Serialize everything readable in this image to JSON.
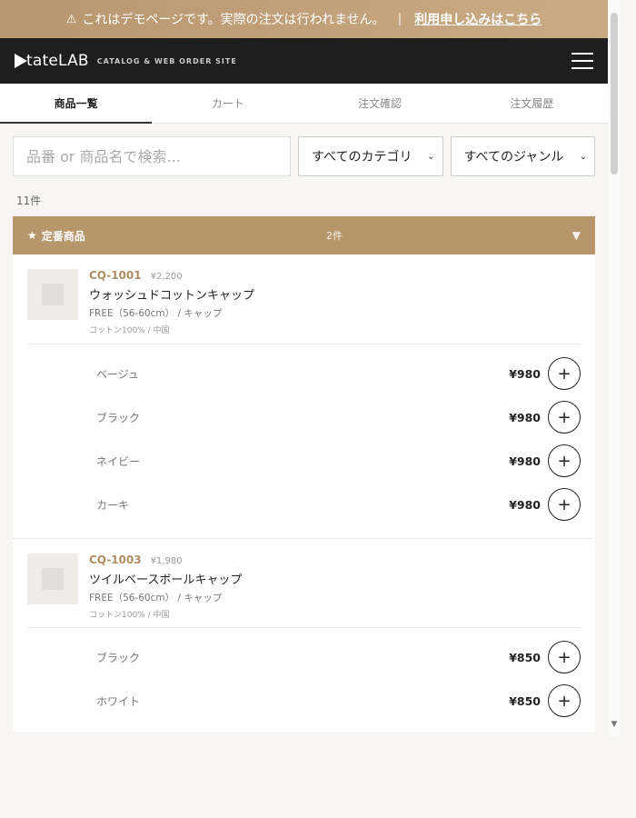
{
  "banner": {
    "icon": "warning-icon",
    "text": "これはデモページです。実際の注文は行われません。",
    "separator": "|",
    "link": "利用申し込みはこちら"
  },
  "header": {
    "logo_text": "tateLAB",
    "logo_sub": "CATALOG & WEB ORDER SITE"
  },
  "tabs": [
    {
      "label": "商品一覧"
    },
    {
      "label": "カート"
    },
    {
      "label": "注文確認"
    },
    {
      "label": "注文履歴"
    }
  ],
  "filters": {
    "search_placeholder": "品番 or 商品名で検索...",
    "category": "すべてのカテゴリ",
    "genre": "すべてのジャンル"
  },
  "result_count": "11件",
  "section": {
    "star": "★",
    "title": "定番商品",
    "count": "2件",
    "toggle": "▼"
  },
  "products": [
    {
      "code": "CQ-1001",
      "price": "¥2,200",
      "name": "ウォッシュドコットンキャップ",
      "size": "FREE（56-60cm） / キャップ",
      "material": "コットン100% / 中国",
      "variants": [
        {
          "name": "ベージュ",
          "price": "¥980"
        },
        {
          "name": "ブラック",
          "price": "¥980"
        },
        {
          "name": "ネイビー",
          "price": "¥980"
        },
        {
          "name": "カーキ",
          "price": "¥980"
        }
      ]
    },
    {
      "code": "CQ-1003",
      "price": "¥1,980",
      "name": "ツイルベースボールキャップ",
      "size": "FREE（56-60cm） / キャップ",
      "material": "コットン100% / 中国",
      "variants": [
        {
          "name": "ブラック",
          "price": "¥850"
        },
        {
          "name": "ホワイト",
          "price": "¥850"
        }
      ]
    }
  ],
  "add_symbol": "+",
  "colors": {
    "accent": "#b8966c",
    "header_bg": "#1e1e1e",
    "banner_bg": "#c4a47c"
  }
}
